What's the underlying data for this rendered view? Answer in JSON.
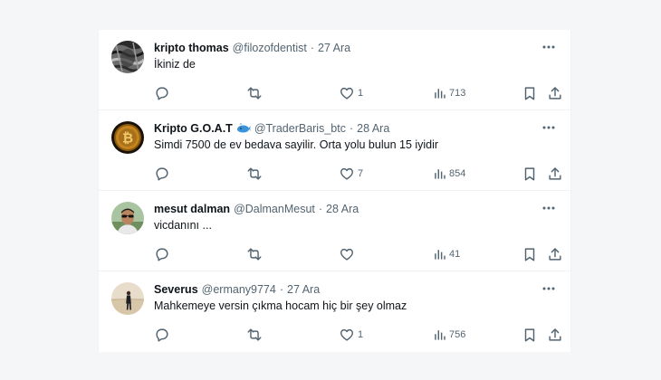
{
  "tweets": [
    {
      "name": "kripto thomas",
      "handle": "@filozofdentist",
      "separator": "·",
      "date": "27 Ara",
      "text": "İkiniz de",
      "likes": "1",
      "views": "713",
      "avatar_icon": "grayscale-portrait-avatar"
    },
    {
      "name": "Kripto G.O.A.T",
      "handle": "@TraderBaris_btc",
      "separator": "·",
      "date": "28 Ara",
      "text": "Simdi 7500 de ev bedava sayilir. Orta yolu bulun 15 iyidir",
      "likes": "7",
      "views": "854",
      "avatar_icon": "bitcoin-coin-avatar",
      "badge_icon": "whale-emoji-icon"
    },
    {
      "name": "mesut dalman",
      "handle": "@DalmanMesut",
      "separator": "·",
      "date": "28 Ara",
      "text": "vicdanını ...",
      "likes": "",
      "views": "41",
      "avatar_icon": "man-sunglasses-avatar"
    },
    {
      "name": "Severus",
      "handle": "@ermany9774",
      "separator": "·",
      "date": "27 Ara",
      "text": "Mahkemeye versin çıkma hocam hiç bir şey olmaz",
      "likes": "1",
      "views": "756",
      "avatar_icon": "person-on-beach-avatar"
    }
  ],
  "colors": {
    "text": "#0f1419",
    "secondary": "#536471",
    "border": "#eff3f4",
    "background": "#f5f6f7"
  }
}
